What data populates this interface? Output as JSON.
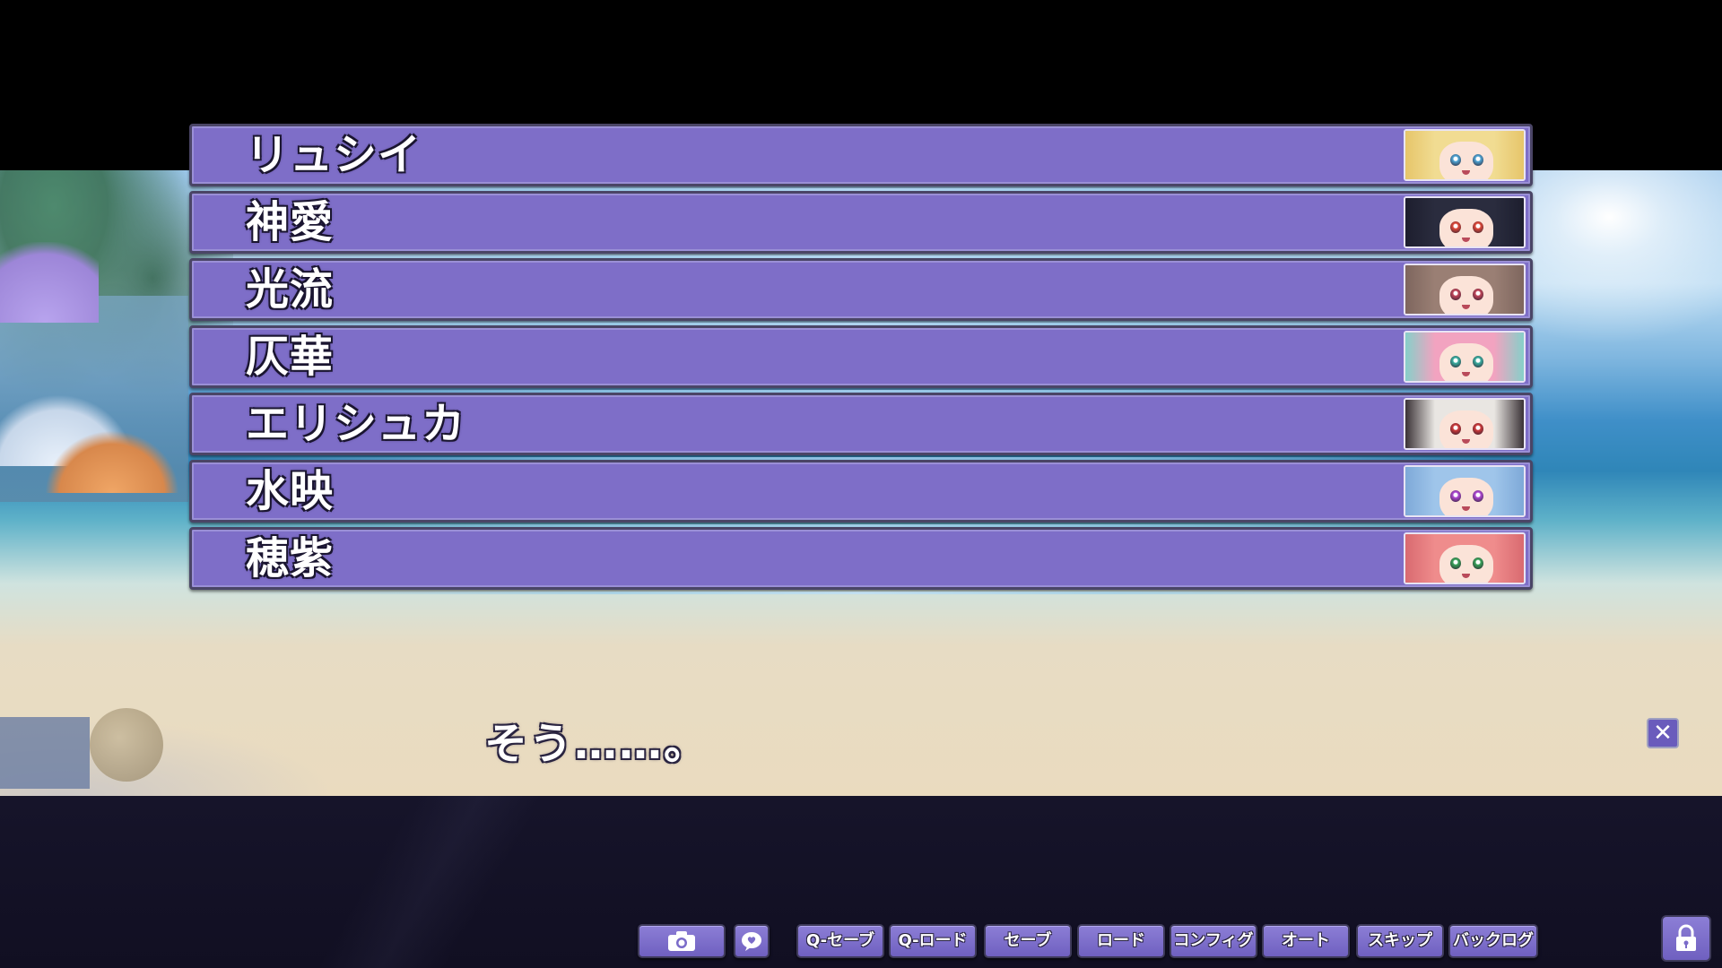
{
  "choices": [
    {
      "label": "リュシイ",
      "hair": "#f1dc92",
      "hair2": "#e6c56a",
      "eye": "#4fa6d6"
    },
    {
      "label": "神愛",
      "hair": "#2a2c3e",
      "hair2": "#1d1e2e",
      "eye": "#e24a3a"
    },
    {
      "label": "光流",
      "hair": "#9a7f74",
      "hair2": "#7e665e",
      "eye": "#c2465a"
    },
    {
      "label": "仄華",
      "hair": "#f2a3c0",
      "hair2": "#86cfc9",
      "eye": "#3bb0a2"
    },
    {
      "label": "エリシュカ",
      "hair": "#e9e6e2",
      "hair2": "#3a3236",
      "eye": "#d03a3a"
    },
    {
      "label": "水映",
      "hair": "#9fc5ea",
      "hair2": "#7ea9d8",
      "eye": "#b14ad6"
    },
    {
      "label": "穂紫",
      "hair": "#ef8c8c",
      "hair2": "#d96a70",
      "eye": "#3aa55a"
    }
  ],
  "dialogue": {
    "text": "そう……。"
  },
  "close_button": {
    "icon": "close-icon",
    "symbol": "✕"
  },
  "toolbar": {
    "screenshot_icon": "camera-icon",
    "favorite_icon": "heart-bubble-icon",
    "qsave": "Q-セーブ",
    "qload": "Q-ロード",
    "save": "セーブ",
    "load": "ロード",
    "config": "コンフィグ",
    "auto": "オート",
    "skip": "スキップ",
    "backlog": "バックログ",
    "lock_icon": "lock-icon"
  },
  "colors": {
    "choice_bg": "#7e6ec8",
    "button_bg": "#7a6bc9",
    "panel_bg": "#14122a"
  }
}
